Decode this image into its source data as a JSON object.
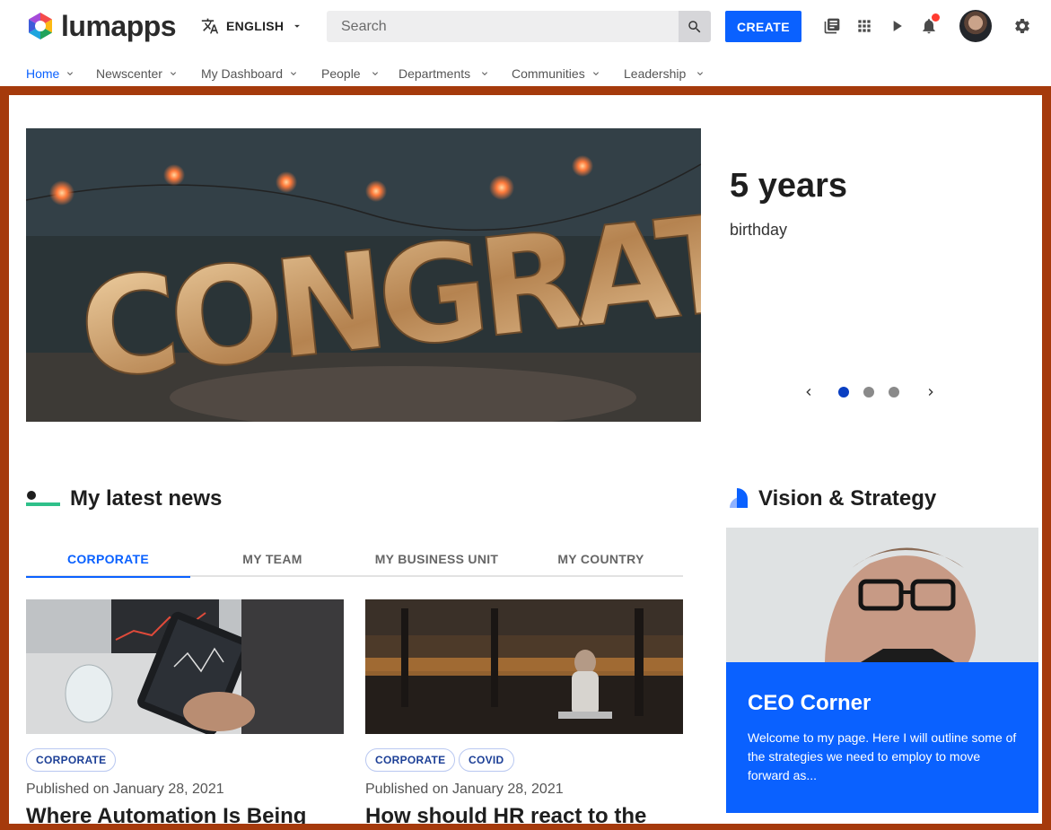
{
  "app": {
    "brand": "lumapps"
  },
  "header": {
    "language": "ENGLISH",
    "search_placeholder": "Search",
    "create_label": "CREATE",
    "accent_color": "#0a61ff"
  },
  "nav": {
    "items": [
      {
        "label": "Home",
        "active": true
      },
      {
        "label": "Newscenter"
      },
      {
        "label": "My Dashboard"
      },
      {
        "label": "People"
      },
      {
        "label": "Departments"
      },
      {
        "label": "Communities"
      },
      {
        "label": "Leadership"
      }
    ]
  },
  "hero": {
    "image_text": "CONGRATS",
    "title": "5 years",
    "subtitle": "birthday",
    "slides": 3,
    "active_slide": 1
  },
  "news": {
    "title": "My latest news",
    "tabs": [
      "CORPORATE",
      "MY TEAM",
      "MY BUSINESS UNIT",
      "MY COUNTRY"
    ],
    "active_tab": 0,
    "cards": [
      {
        "tags": [
          "CORPORATE"
        ],
        "published": "Published on January 28, 2021",
        "title": "Where Automation Is Being"
      },
      {
        "tags": [
          "CORPORATE",
          "COVID"
        ],
        "published": "Published on January 28, 2021",
        "title": "How should HR react to the"
      }
    ]
  },
  "vision": {
    "title": "Vision & Strategy",
    "ceo_title": "CEO Corner",
    "ceo_desc": "Welcome to my page. Here I will outline some of the strategies we need to employ to move forward as..."
  },
  "colors": {
    "frame": "#a53a0c",
    "primary": "#0a61ff",
    "dot_active": "#0a3fc2"
  }
}
